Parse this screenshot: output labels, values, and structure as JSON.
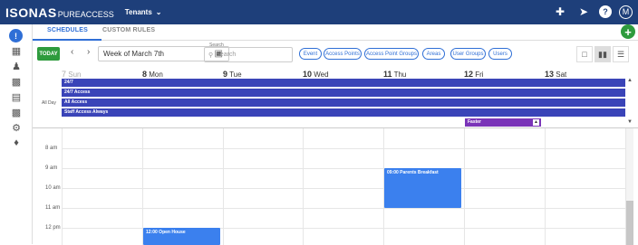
{
  "header": {
    "logo_main": "ISONAS",
    "logo_sub": "PUREACCESS",
    "tenants_label": "Tenants",
    "user_initial": "M"
  },
  "tabs": [
    {
      "label": "SCHEDULES",
      "active": true
    },
    {
      "label": "CUSTOM RULES",
      "active": false
    }
  ],
  "toolbar": {
    "today_label": "TODAY",
    "week_value": "Week of March 7th",
    "search_label": "Search",
    "search_placeholder": "Search",
    "chips": [
      "Event",
      "Access Points",
      "Access Point Groups",
      "Areas",
      "User Groups",
      "Users"
    ]
  },
  "calendar": {
    "days": [
      {
        "num": "7",
        "name": "Sun",
        "muted": true
      },
      {
        "num": "8",
        "name": "Mon",
        "muted": false
      },
      {
        "num": "9",
        "name": "Tue",
        "muted": false
      },
      {
        "num": "10",
        "name": "Wed",
        "muted": false
      },
      {
        "num": "11",
        "name": "Thu",
        "muted": false
      },
      {
        "num": "12",
        "name": "Fri",
        "muted": false
      },
      {
        "num": "13",
        "name": "Sat",
        "muted": false
      }
    ],
    "allday_label": "All Day",
    "allday_events": [
      "24/7",
      "24/7 Access",
      "All Access",
      "Staff Access Always"
    ],
    "faster_event": "Faster",
    "times": [
      "8 am",
      "9 am",
      "10 am",
      "11 am",
      "12 pm"
    ],
    "events": [
      {
        "title": "09:00 Parents Breakfast",
        "day": "Thu"
      },
      {
        "title": "12:00 Open House",
        "day": "Mon"
      }
    ]
  },
  "colors": {
    "header_bg": "#1e3f7a",
    "accent": "#2f6fd6",
    "today_green": "#2e9b3d",
    "allday_event": "#3a44b8",
    "purple_event": "#7a34b8",
    "timed_event": "#3b80ee"
  }
}
